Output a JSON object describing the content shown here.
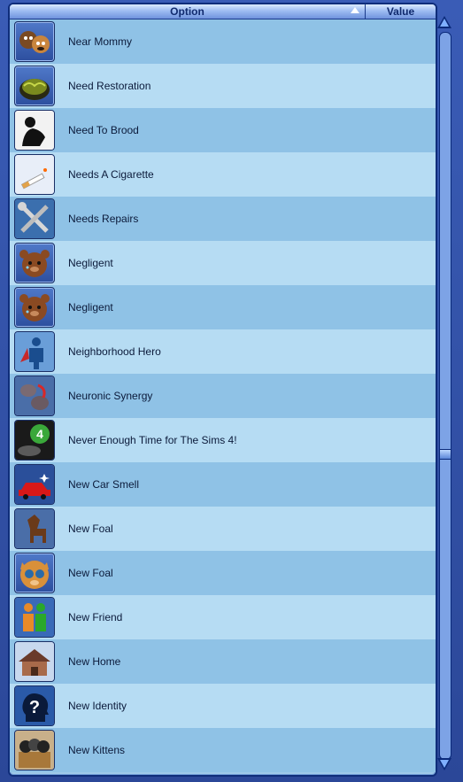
{
  "header": {
    "option_label": "Option",
    "value_label": "Value",
    "sort_icon": "sort-ascending-icon"
  },
  "rows": [
    {
      "label": "Near Mommy",
      "icon": "puppies-icon",
      "value": ""
    },
    {
      "label": "Need Restoration",
      "icon": "rotten-food-icon",
      "value": ""
    },
    {
      "label": "Need To Brood",
      "icon": "brooding-silhouette-icon",
      "value": ""
    },
    {
      "label": "Needs A Cigarette",
      "icon": "cigarette-icon",
      "value": ""
    },
    {
      "label": "Needs Repairs",
      "icon": "tools-icon",
      "value": ""
    },
    {
      "label": "Negligent",
      "icon": "crying-teddy-bear-icon",
      "value": ""
    },
    {
      "label": "Negligent",
      "icon": "crying-teddy-bear-icon",
      "value": ""
    },
    {
      "label": "Neighborhood Hero",
      "icon": "hero-silhouette-icon",
      "value": ""
    },
    {
      "label": "Neuronic Synergy",
      "icon": "brain-synergy-icon",
      "value": ""
    },
    {
      "label": "Never Enough Time for The Sims 4!",
      "icon": "sims4-plumbob-icon",
      "value": ""
    },
    {
      "label": "New Car Smell",
      "icon": "red-car-icon",
      "value": ""
    },
    {
      "label": "New Foal",
      "icon": "foal-icon",
      "value": ""
    },
    {
      "label": "New Foal",
      "icon": "kitten-face-icon",
      "value": ""
    },
    {
      "label": "New Friend",
      "icon": "friends-silhouettes-icon",
      "value": ""
    },
    {
      "label": "New Home",
      "icon": "house-icon",
      "value": ""
    },
    {
      "label": "New Identity",
      "icon": "question-head-icon",
      "value": ""
    },
    {
      "label": "New Kittens",
      "icon": "kittens-in-box-icon",
      "value": ""
    }
  ],
  "scrollbar": {
    "position": 0.58
  },
  "colors": {
    "row_odd": "#8fc2e6",
    "row_even": "#b6dcf3",
    "frame": "#2f4d9e",
    "header_text": "#102a6e"
  }
}
